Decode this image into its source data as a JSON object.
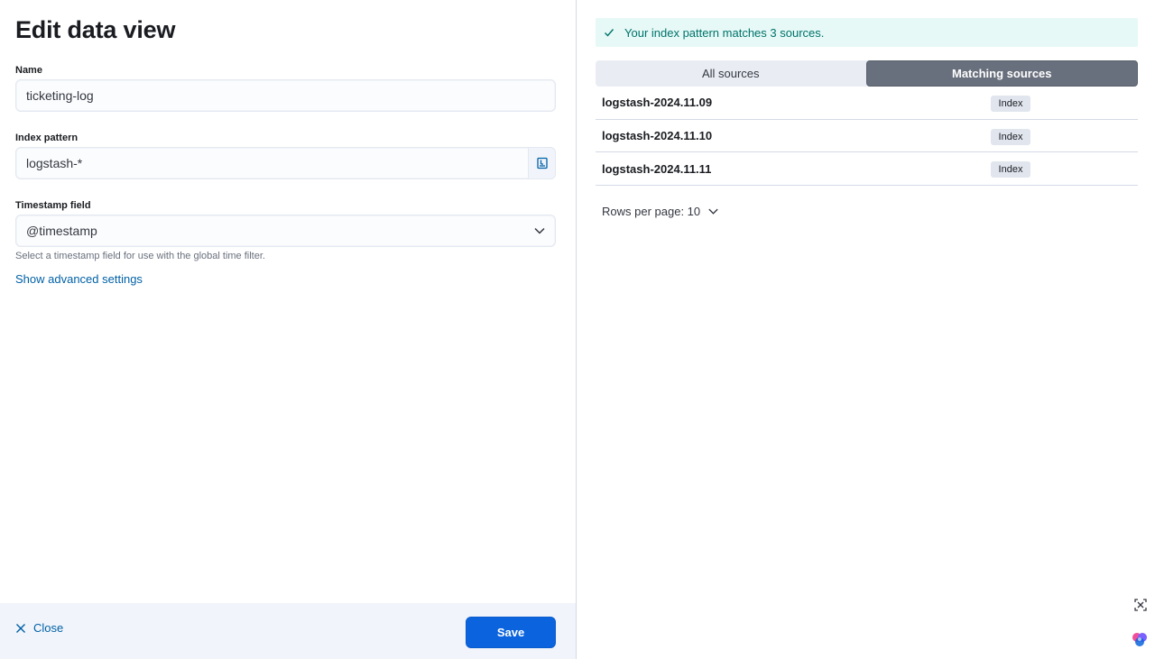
{
  "page": {
    "title": "Edit data view"
  },
  "form": {
    "name": {
      "label": "Name",
      "value": "ticketing-log"
    },
    "index_pattern": {
      "label": "Index pattern",
      "value": "logstash-*"
    },
    "timestamp_field": {
      "label": "Timestamp field",
      "value": "@timestamp",
      "help": "Select a timestamp field for use with the global time filter."
    },
    "advanced_link": "Show advanced settings"
  },
  "footer": {
    "close_label": "Close",
    "save_label": "Save"
  },
  "preview": {
    "callout": "Your index pattern matches 3 sources.",
    "tabs": [
      {
        "label": "All sources",
        "active": false
      },
      {
        "label": "Matching sources",
        "active": true
      }
    ],
    "sources": [
      {
        "name": "logstash-2024.11.09",
        "type": "Index"
      },
      {
        "name": "logstash-2024.11.10",
        "type": "Index"
      },
      {
        "name": "logstash-2024.11.11",
        "type": "Index"
      }
    ],
    "rows_per_page": "Rows per page: 10"
  },
  "icons": {
    "close": "close-icon",
    "check": "check-icon",
    "chevron": "chevron-down-icon",
    "index_browser": "index-browser-icon",
    "focus": "focus-icon",
    "ai_assistant": "ai-assistant-icon"
  },
  "colors": {
    "primary": "#0b64dd",
    "link": "#0061a6",
    "success_text": "#00726b",
    "success_bg": "#e6f9f6",
    "active_tab": "#69707d"
  }
}
